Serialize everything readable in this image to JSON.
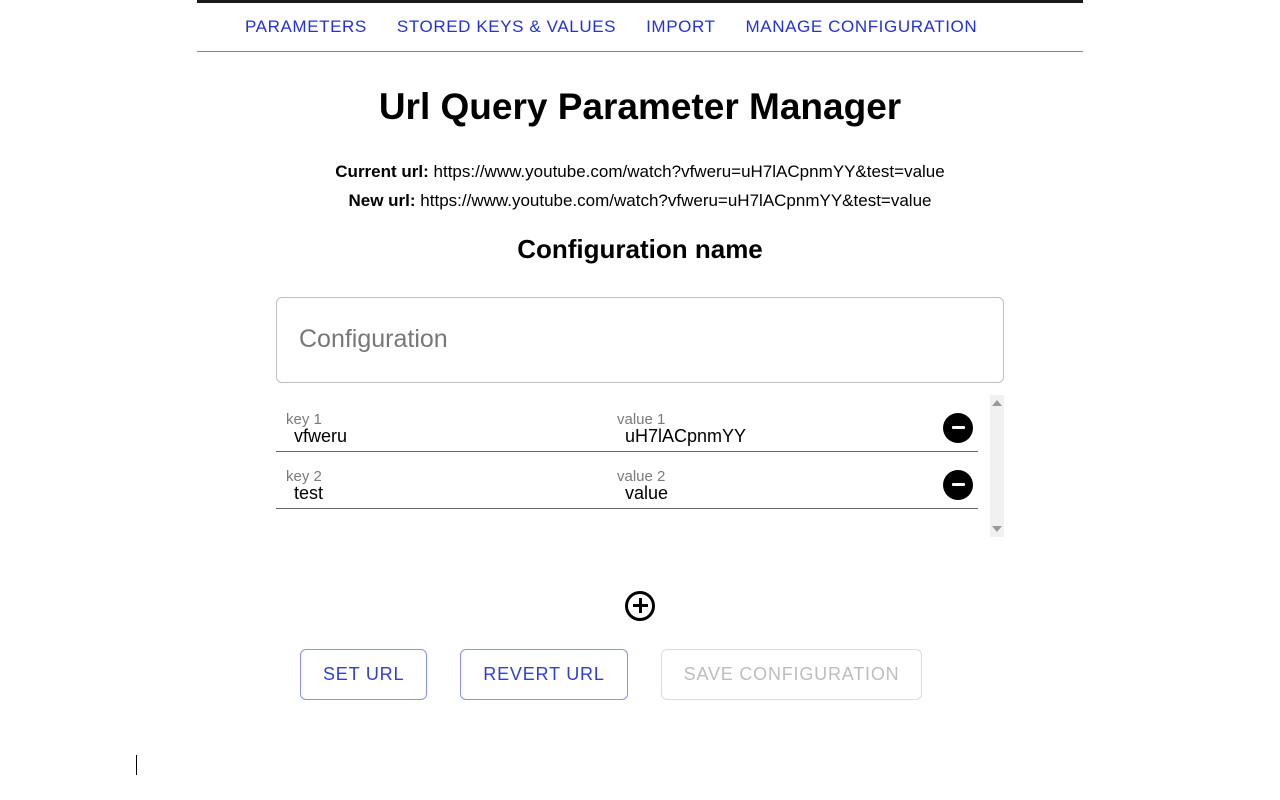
{
  "tabs": {
    "parameters": "PARAMETERS",
    "stored": "STORED KEYS & VALUES",
    "import": "IMPORT",
    "manage": "MANAGE CONFIGURATION"
  },
  "title": "Url Query Parameter Manager",
  "urls": {
    "current_label": "Current url:",
    "current_value": "https://www.youtube.com/watch?vfweru=uH7lACpnmYY&test=value",
    "new_label": "New url:",
    "new_value": "https://www.youtube.com/watch?vfweru=uH7lACpnmYY&test=value"
  },
  "config_heading": "Configuration name",
  "config_input": {
    "placeholder": "Configuration",
    "value": ""
  },
  "rows": [
    {
      "key_label": "key 1",
      "key_value": "vfweru",
      "value_label": "value 1",
      "value_value": "uH7lACpnmYY"
    },
    {
      "key_label": "key 2",
      "key_value": "test",
      "value_label": "value 2",
      "value_value": "value"
    }
  ],
  "buttons": {
    "set": "SET URL",
    "revert": "REVERT URL",
    "save": "SAVE CONFIGURATION"
  }
}
